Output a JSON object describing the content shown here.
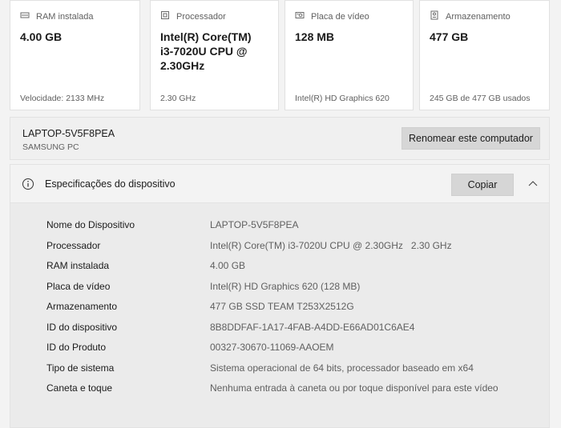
{
  "cards": [
    {
      "icon": "ram-icon",
      "label": "RAM instalada",
      "value_lines": [
        "4.00 GB"
      ],
      "sub": "Velocidade: 2133 MHz"
    },
    {
      "icon": "processor-icon",
      "label": "Processador",
      "value_lines": [
        "Intel(R) Core(TM)",
        "i3-7020U CPU @",
        "2.30GHz"
      ],
      "sub": "2.30 GHz"
    },
    {
      "icon": "graphics-card-icon",
      "label": "Placa de vídeo",
      "value_lines": [
        "128 MB"
      ],
      "sub": "Intel(R) HD Graphics 620"
    },
    {
      "icon": "storage-icon",
      "label": "Armazenamento",
      "value_lines": [
        "477 GB"
      ],
      "sub": "245 GB de 477 GB usados"
    }
  ],
  "computer": {
    "name": "LAPTOP-5V5F8PEA",
    "model": "SAMSUNG PC",
    "rename_label": "Renomear este computador"
  },
  "specs": {
    "title": "Especificações do dispositivo",
    "copy_label": "Copiar",
    "rows": [
      {
        "key": "Nome do Dispositivo",
        "value": "LAPTOP-5V5F8PEA"
      },
      {
        "key": "Processador",
        "value": "Intel(R) Core(TM) i3-7020U CPU @ 2.30GHz   2.30 GHz"
      },
      {
        "key": "RAM instalada",
        "value": "4.00 GB"
      },
      {
        "key": "Placa de vídeo",
        "value": "Intel(R) HD Graphics 620 (128 MB)"
      },
      {
        "key": "Armazenamento",
        "value": "477 GB SSD TEAM T253X2512G"
      },
      {
        "key": "ID do dispositivo",
        "value": "8B8DDFAF-1A17-4FAB-A4DD-E66AD01C6AE4"
      },
      {
        "key": "ID do Produto",
        "value": "00327-30670-11069-AAOEM"
      },
      {
        "key": "Tipo de sistema",
        "value": "Sistema operacional de 64 bits, processador baseado em x64"
      },
      {
        "key": "Caneta e toque",
        "value": "Nenhuma entrada à caneta ou por toque disponível para este vídeo"
      }
    ]
  }
}
